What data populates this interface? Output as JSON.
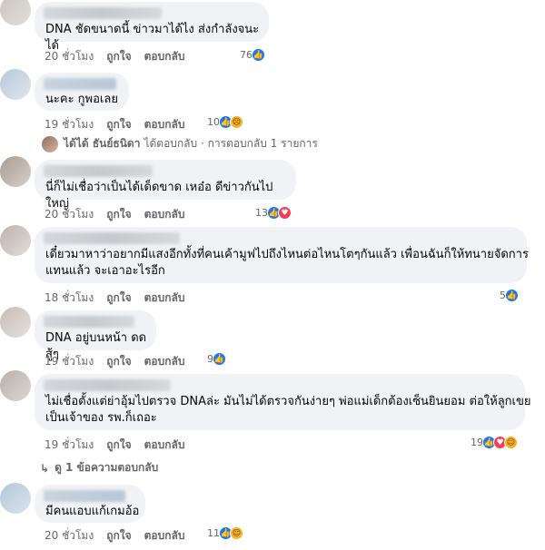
{
  "comments": [
    {
      "text_lines": [
        "DNA ชัดขนาดนี้ ข่าวมาได้ไง ส่งกำลังจนะได้"
      ],
      "time": "20 ชั่วโมง",
      "like": "ถูกใจ",
      "reply": "ตอบกลับ",
      "reaction_count": "76",
      "reactions": [
        "like-icon"
      ]
    },
    {
      "text_lines": [
        "นะคะ กูพอเลย"
      ],
      "time": "19 ชั่วโมง",
      "like": "ถูกใจ",
      "reply": "ตอบกลับ",
      "reaction_count": "10",
      "reactions": [
        "like-icon",
        "sad-icon"
      ]
    },
    {
      "text_lines": [
        "นี่ก็ไม่เชื่อว่าเป็นได้เด็ดขาด เหอ๋อ ดีข่าวกันไปใหญ่"
      ],
      "time": "20 ชั่วโมง",
      "like": "ถูกใจ",
      "reply": "ตอบกลับ",
      "reaction_count": "13",
      "reactions": [
        "like-icon",
        "love-icon"
      ]
    },
    {
      "text_lines": [
        "เดี๋ยวมาหาว่าอยากมีแสงอีกทั้งที่คนเค้ามูฟไปถึงไหนต่อไหนโตๆกันแล้ว เพื่อนฉันก็ให้ทนายจัดการ",
        "แทนแล้ว จะเอาอะไรอีก"
      ],
      "time": "18 ชั่วโมง",
      "like": "ถูกใจ",
      "reply": "ตอบกลับ",
      "reaction_count": "5",
      "reactions": [
        "like-icon"
      ]
    },
    {
      "text_lines": [
        "DNA อยู่บนหน้า ดด สู้ๆ"
      ],
      "time": "19 ชั่วโมง",
      "like": "ถูกใจ",
      "reply": "ตอบกลับ",
      "reaction_count": "9",
      "reactions": [
        "like-icon"
      ]
    },
    {
      "text_lines": [
        "ไม่เชื่อตั้งแต่ย่าอุ้มไปตรวจ DNAล่ะ มันไม่ได้ตรวจกันง่ายๆ พ่อแม่เด็กต้องเซ็นยินยอม ต่อให้ลูกเขย",
        "เป็นเจ้าของ รพ.ก็เถอะ"
      ],
      "time": "19 ชั่วโมง",
      "like": "ถูกใจ",
      "reply": "ตอบกลับ",
      "reaction_count": "19",
      "reactions": [
        "like-icon",
        "love-icon",
        "haha-icon"
      ]
    },
    {
      "text_lines": [
        "มีคนแอบแก้เกมอ้อ"
      ],
      "time": "20 ชั่วโมง",
      "like": "ถูกใจ",
      "reply": "ตอบกลับ",
      "reaction_count": "11",
      "reactions": [
        "like-icon",
        "haha-icon"
      ]
    }
  ],
  "reply_summary": {
    "name": "ได้ได้ ธันย์ธนิดา",
    "text": "ได้ตอบกลับ · การตอบกลับ 1 รายการ"
  },
  "view_replies": "ดู 1 ข้อความตอบกลับ",
  "colors": {
    "bubble": "#f0f2f5",
    "meta": "#65676b",
    "like": "#1877f2",
    "love": "#f33e58",
    "emoji": "#f7b125"
  }
}
